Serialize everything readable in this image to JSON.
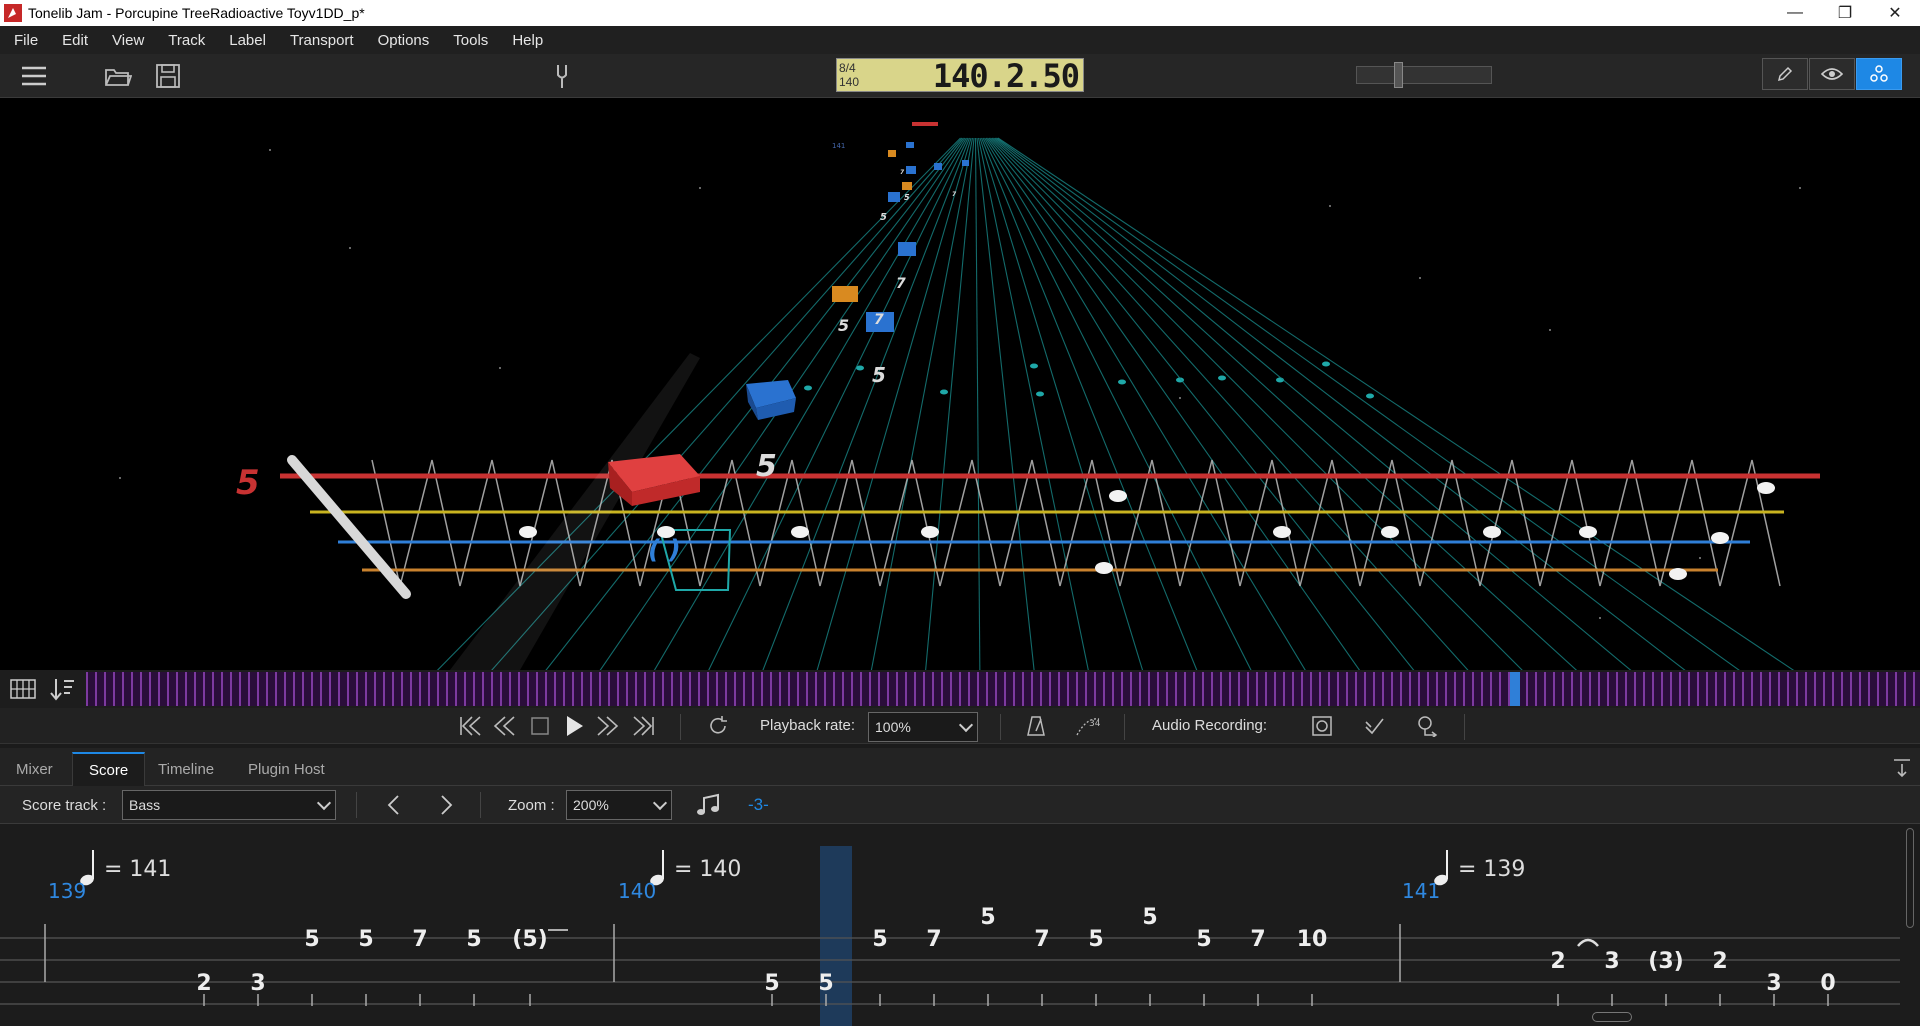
{
  "window": {
    "title": "Tonelib Jam - Porcupine TreeRadioactive Toyv1DD_p*"
  },
  "menu": [
    "File",
    "Edit",
    "View",
    "Track",
    "Label",
    "Transport",
    "Options",
    "Tools",
    "Help"
  ],
  "lcd": {
    "time_signature": "8/4",
    "tempo": "140",
    "position": "140.2.50"
  },
  "highway": {
    "fret_number": "5",
    "numbers": [
      "5",
      "7",
      "5",
      "7",
      "5",
      "5",
      "5",
      "7",
      "7"
    ],
    "small_number": "141",
    "colors": {
      "red": "#c83232",
      "yellow": "#c9b420",
      "blue": "#2f7fd8",
      "orange": "#c9822e",
      "teal": "#1fa8a8"
    }
  },
  "transport": {
    "playback_rate_label": "Playback rate:",
    "playback_rate_value": "100%",
    "audio_recording_label": "Audio Recording:"
  },
  "tabs": [
    "Mixer",
    "Score",
    "Timeline",
    "Plugin Host"
  ],
  "score_toolbar": {
    "track_label": "Score track :",
    "track_value": "Bass",
    "zoom_label": "Zoom :",
    "zoom_value": "200%",
    "tuplet_label": "-3-"
  },
  "score": {
    "measures": [
      {
        "number": "139",
        "tempo": "= 141"
      },
      {
        "number": "140",
        "tempo": "= 140"
      },
      {
        "number": "141",
        "tempo": "= 139"
      }
    ],
    "notes": [
      {
        "text": "2",
        "string": 3
      },
      {
        "text": "3",
        "string": 3
      },
      {
        "text": "5",
        "string": 1
      },
      {
        "text": "5",
        "string": 1
      },
      {
        "text": "7",
        "string": 1
      },
      {
        "text": "5",
        "string": 1
      },
      {
        "text": "(5)",
        "string": 1
      },
      {
        "text": "5",
        "string": 3
      },
      {
        "text": "5",
        "string": 3
      },
      {
        "text": "5",
        "string": 1
      },
      {
        "text": "7",
        "string": 1
      },
      {
        "text": "5",
        "string": 0
      },
      {
        "text": "7",
        "string": 1
      },
      {
        "text": "5",
        "string": 1
      },
      {
        "text": "5",
        "string": 0
      },
      {
        "text": "5",
        "string": 1
      },
      {
        "text": "7",
        "string": 1
      },
      {
        "text": "10",
        "string": 1
      },
      {
        "text": "2",
        "string": 2
      },
      {
        "text": "3",
        "string": 2
      },
      {
        "text": "(3)",
        "string": 2
      },
      {
        "text": "2",
        "string": 2
      },
      {
        "text": "3",
        "string": 3
      },
      {
        "text": "0",
        "string": 3
      }
    ]
  },
  "accent": "#1e88e5"
}
